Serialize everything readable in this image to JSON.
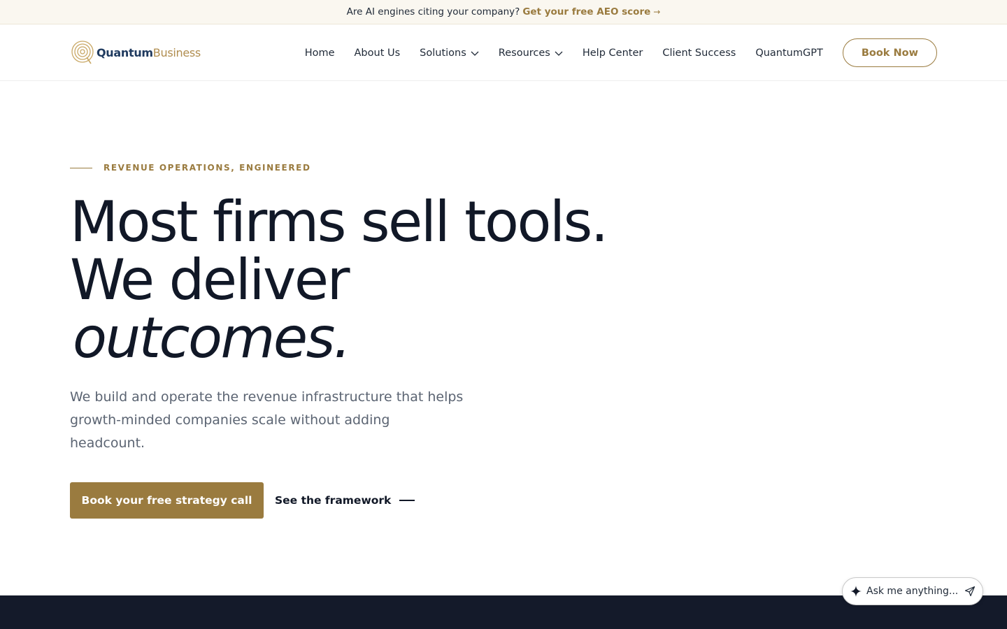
{
  "announcement": {
    "text": "Are AI engines citing your company?",
    "link": "Get your free AEO score",
    "arrow": "→"
  },
  "brand": {
    "name_primary": "Quantum",
    "name_secondary": "Business",
    "icon": "quantum-rings-logo-icon",
    "colors": {
      "gold": "#9a7b3f",
      "navy": "#1f3a5f"
    }
  },
  "nav": {
    "items": [
      {
        "label": "Home"
      },
      {
        "label": "About Us"
      },
      {
        "label": "Solutions",
        "icon": "chevron-down-icon"
      },
      {
        "label": "Resources",
        "icon": "chevron-down-icon"
      },
      {
        "label": "Help Center"
      },
      {
        "label": "Client Success"
      },
      {
        "label": "QuantumGPT"
      }
    ],
    "cta": "Book Now"
  },
  "hero": {
    "eyebrow": "REVENUE OPERATIONS, ENGINEERED",
    "headline_line1": "Most firms sell tools.",
    "headline_line2": "We deliver",
    "headline_line3": "outcomes.",
    "subcopy": "We build and operate the revenue infrastructure that helps growth-minded companies scale without adding headcount.",
    "cta_primary": "Book your free strategy call",
    "cta_secondary": "See the framework"
  },
  "assistant": {
    "placeholder": "Ask me anything...",
    "icon": "sparkle-icon",
    "send_icon": "send-icon"
  }
}
